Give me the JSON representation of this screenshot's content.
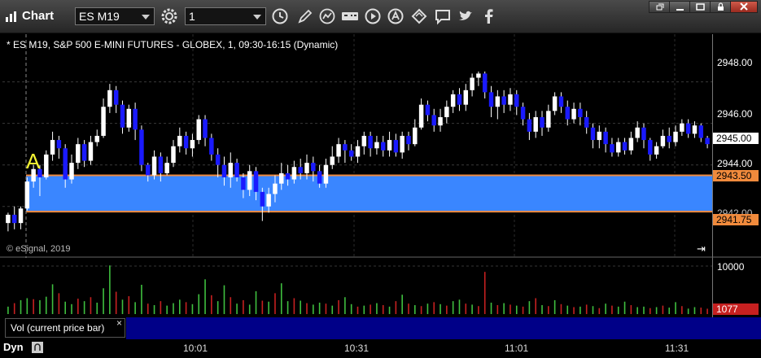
{
  "app": {
    "title": "Chart"
  },
  "toolbar": {
    "symbol_value": "ES M19",
    "interval_value": "1",
    "icons": [
      "gear-icon",
      "clock-icon",
      "pencil-icon",
      "studies-icon",
      "get-icon",
      "play-icon",
      "alert-icon",
      "link-icon",
      "chat-icon",
      "twitter-icon",
      "facebook-icon"
    ]
  },
  "chart": {
    "title": "* ES M19, S&P 500 E-MINI FUTURES - GLOBEX, 1, 09:30-16:15 (Dynamic)",
    "copyright": "© eSignal, 2019",
    "marker_label": "A",
    "price_axis": [
      "2948.00",
      "2946.00",
      "2944.00",
      "2942.00"
    ],
    "last_price": "2945.00",
    "zone_top": "2943.50",
    "zone_bottom": "2941.75",
    "volume_axis": "10000",
    "volume_last": "1077",
    "time_labels": [
      "10:01",
      "10:31",
      "11:01",
      "11:31"
    ],
    "legend": "Vol (current price bar)",
    "legend_close": "×",
    "bottom_label": "Dyn",
    "colors": {
      "up": "#ffffff",
      "down": "#1a1aff",
      "zone": "#3a86ff",
      "zone_line": "#f08a3c",
      "vol_up": "#3fbf3f",
      "vol_down": "#c62020"
    }
  },
  "chart_data": {
    "type": "candlestick",
    "ylim": [
      2940.5,
      2949.2
    ],
    "zone": [
      2941.75,
      2943.5
    ],
    "candles": [
      [
        2941.2,
        2941.6,
        2940.8,
        2941.7
      ],
      [
        2941.6,
        2941.2,
        2940.9,
        2942.0
      ],
      [
        2941.2,
        2941.9,
        2940.9,
        2942.0
      ],
      [
        2941.9,
        2943.2,
        2941.8,
        2943.4
      ],
      [
        2943.2,
        2943.8,
        2942.9,
        2944.0
      ],
      [
        2943.8,
        2943.4,
        2942.5,
        2944.0
      ],
      [
        2943.4,
        2944.5,
        2943.3,
        2944.7
      ],
      [
        2944.5,
        2945.2,
        2944.2,
        2945.6
      ],
      [
        2945.2,
        2944.8,
        2944.3,
        2945.4
      ],
      [
        2944.8,
        2943.3,
        2942.9,
        2945.0
      ],
      [
        2943.3,
        2944.1,
        2943.1,
        2944.5
      ],
      [
        2944.1,
        2945.0,
        2943.8,
        2945.3
      ],
      [
        2945.0,
        2944.2,
        2943.9,
        2945.2
      ],
      [
        2944.2,
        2945.1,
        2944.0,
        2945.4
      ],
      [
        2945.1,
        2945.4,
        2944.9,
        2945.7
      ],
      [
        2945.4,
        2946.8,
        2945.3,
        2947.2
      ],
      [
        2946.8,
        2947.6,
        2946.5,
        2947.9
      ],
      [
        2947.6,
        2946.9,
        2946.5,
        2947.8
      ],
      [
        2946.9,
        2945.8,
        2945.5,
        2947.1
      ],
      [
        2945.8,
        2946.7,
        2945.6,
        2946.9
      ],
      [
        2946.7,
        2945.7,
        2945.2,
        2947.0
      ],
      [
        2945.7,
        2944.0,
        2943.7,
        2945.9
      ],
      [
        2944.0,
        2943.5,
        2943.2,
        2944.1
      ],
      [
        2943.5,
        2944.4,
        2943.3,
        2944.7
      ],
      [
        2944.4,
        2943.6,
        2943.2,
        2944.6
      ],
      [
        2943.6,
        2944.1,
        2943.5,
        2944.4
      ],
      [
        2944.1,
        2944.9,
        2943.9,
        2945.2
      ],
      [
        2944.9,
        2945.4,
        2944.6,
        2945.8
      ],
      [
        2945.4,
        2944.8,
        2944.5,
        2945.6
      ],
      [
        2944.8,
        2945.2,
        2944.4,
        2945.5
      ],
      [
        2945.2,
        2946.2,
        2945.0,
        2946.4
      ],
      [
        2946.2,
        2945.3,
        2944.9,
        2946.4
      ],
      [
        2945.3,
        2944.5,
        2944.2,
        2945.5
      ],
      [
        2944.5,
        2944.0,
        2943.4,
        2944.8
      ],
      [
        2944.0,
        2943.4,
        2943.0,
        2944.4
      ],
      [
        2943.4,
        2944.1,
        2942.9,
        2944.6
      ],
      [
        2944.1,
        2943.4,
        2943.2,
        2944.3
      ],
      [
        2943.4,
        2942.8,
        2942.4,
        2943.6
      ],
      [
        2942.8,
        2943.7,
        2942.5,
        2944.0
      ],
      [
        2943.7,
        2942.7,
        2942.3,
        2943.9
      ],
      [
        2942.7,
        2942.0,
        2941.3,
        2942.9
      ],
      [
        2942.0,
        2942.6,
        2941.7,
        2942.9
      ],
      [
        2942.6,
        2943.1,
        2942.2,
        2943.5
      ],
      [
        2943.1,
        2943.6,
        2942.8,
        2944.1
      ],
      [
        2943.6,
        2943.3,
        2943.0,
        2944.0
      ],
      [
        2943.3,
        2943.9,
        2943.1,
        2944.2
      ],
      [
        2943.9,
        2943.6,
        2943.3,
        2944.3
      ],
      [
        2943.6,
        2944.1,
        2943.3,
        2944.5
      ],
      [
        2944.1,
        2943.7,
        2943.2,
        2944.4
      ],
      [
        2943.7,
        2943.1,
        2942.9,
        2944.0
      ],
      [
        2943.1,
        2944.0,
        2942.9,
        2944.3
      ],
      [
        2944.0,
        2944.4,
        2943.8,
        2944.9
      ],
      [
        2944.4,
        2945.0,
        2944.1,
        2945.3
      ],
      [
        2945.0,
        2944.7,
        2944.1,
        2945.2
      ],
      [
        2944.7,
        2944.4,
        2944.2,
        2945.0
      ],
      [
        2944.4,
        2944.9,
        2944.1,
        2945.2
      ],
      [
        2944.9,
        2945.4,
        2944.5,
        2945.6
      ],
      [
        2945.4,
        2944.8,
        2944.4,
        2945.6
      ],
      [
        2944.8,
        2945.1,
        2944.5,
        2945.4
      ],
      [
        2945.1,
        2944.7,
        2944.4,
        2945.4
      ],
      [
        2944.7,
        2945.2,
        2944.4,
        2945.6
      ],
      [
        2945.2,
        2944.6,
        2944.4,
        2945.5
      ],
      [
        2944.6,
        2945.4,
        2944.3,
        2945.6
      ],
      [
        2945.4,
        2945.0,
        2944.7,
        2945.6
      ],
      [
        2945.0,
        2945.8,
        2944.9,
        2946.2
      ],
      [
        2945.8,
        2946.9,
        2945.7,
        2947.2
      ],
      [
        2946.9,
        2946.4,
        2946.1,
        2947.1
      ],
      [
        2946.4,
        2945.9,
        2945.6,
        2946.7
      ],
      [
        2945.9,
        2946.3,
        2945.6,
        2946.7
      ],
      [
        2946.3,
        2946.8,
        2946.0,
        2947.1
      ],
      [
        2946.8,
        2947.4,
        2946.5,
        2947.6
      ],
      [
        2947.4,
        2946.9,
        2946.6,
        2947.7
      ],
      [
        2946.9,
        2947.6,
        2946.6,
        2947.9
      ],
      [
        2947.6,
        2948.2,
        2947.3,
        2948.4
      ],
      [
        2948.2,
        2948.4,
        2947.8,
        2948.5
      ],
      [
        2948.4,
        2947.5,
        2947.2,
        2948.5
      ],
      [
        2947.5,
        2946.8,
        2946.3,
        2947.8
      ],
      [
        2946.8,
        2947.3,
        2946.2,
        2947.6
      ],
      [
        2947.3,
        2946.9,
        2946.5,
        2947.6
      ],
      [
        2946.9,
        2947.4,
        2946.6,
        2947.7
      ],
      [
        2947.4,
        2946.8,
        2946.4,
        2947.6
      ],
      [
        2946.8,
        2946.2,
        2945.9,
        2947.0
      ],
      [
        2946.2,
        2945.6,
        2945.2,
        2946.5
      ],
      [
        2945.6,
        2946.3,
        2945.3,
        2946.6
      ],
      [
        2946.3,
        2945.8,
        2945.4,
        2946.6
      ],
      [
        2945.8,
        2946.6,
        2945.6,
        2946.9
      ],
      [
        2946.6,
        2947.3,
        2946.4,
        2947.5
      ],
      [
        2947.3,
        2946.8,
        2946.5,
        2947.5
      ],
      [
        2946.8,
        2946.2,
        2945.9,
        2947.1
      ],
      [
        2946.2,
        2946.7,
        2946.0,
        2947.0
      ],
      [
        2946.7,
        2946.3,
        2945.9,
        2947.0
      ],
      [
        2946.3,
        2945.8,
        2945.5,
        2946.6
      ],
      [
        2945.8,
        2945.2,
        2944.8,
        2946.0
      ],
      [
        2945.2,
        2945.6,
        2944.8,
        2945.9
      ],
      [
        2945.6,
        2945.0,
        2944.6,
        2945.8
      ],
      [
        2945.0,
        2944.6,
        2944.4,
        2945.3
      ],
      [
        2944.6,
        2945.1,
        2944.4,
        2945.3
      ],
      [
        2945.1,
        2944.7,
        2944.5,
        2945.3
      ],
      [
        2944.7,
        2945.3,
        2944.5,
        2945.6
      ],
      [
        2945.3,
        2945.8,
        2945.1,
        2946.1
      ],
      [
        2945.8,
        2945.2,
        2944.8,
        2946.0
      ],
      [
        2945.2,
        2944.5,
        2944.2,
        2945.3
      ],
      [
        2944.5,
        2944.9,
        2944.3,
        2945.1
      ],
      [
        2944.9,
        2945.4,
        2944.8,
        2945.7
      ],
      [
        2945.4,
        2945.1,
        2944.8,
        2945.8
      ],
      [
        2945.1,
        2945.6,
        2944.9,
        2945.9
      ],
      [
        2945.6,
        2946.0,
        2945.4,
        2946.2
      ],
      [
        2946.0,
        2945.5,
        2945.3,
        2946.2
      ],
      [
        2945.5,
        2945.9,
        2945.3,
        2946.1
      ],
      [
        2945.9,
        2945.3,
        2945.1,
        2946.0
      ],
      [
        2945.3,
        2945.0,
        2944.8,
        2945.4
      ]
    ],
    "volume": [
      [
        1500,
        1
      ],
      [
        2200,
        0
      ],
      [
        2800,
        1
      ],
      [
        3200,
        1
      ],
      [
        3000,
        0
      ],
      [
        2800,
        1
      ],
      [
        3500,
        1
      ],
      [
        6000,
        1
      ],
      [
        4200,
        0
      ],
      [
        2500,
        1
      ],
      [
        2000,
        1
      ],
      [
        3100,
        0
      ],
      [
        2600,
        1
      ],
      [
        3400,
        0
      ],
      [
        2300,
        1
      ],
      [
        5200,
        1
      ],
      [
        9800,
        1
      ],
      [
        4500,
        0
      ],
      [
        2900,
        1
      ],
      [
        3600,
        0
      ],
      [
        2400,
        1
      ],
      [
        5900,
        1
      ],
      [
        2100,
        0
      ],
      [
        1800,
        1
      ],
      [
        2600,
        0
      ],
      [
        1700,
        1
      ],
      [
        2200,
        1
      ],
      [
        2900,
        1
      ],
      [
        2400,
        0
      ],
      [
        2000,
        1
      ],
      [
        4000,
        1
      ],
      [
        7000,
        1
      ],
      [
        3800,
        0
      ],
      [
        2600,
        1
      ],
      [
        5800,
        1
      ],
      [
        3400,
        0
      ],
      [
        2100,
        1
      ],
      [
        2800,
        0
      ],
      [
        1900,
        1
      ],
      [
        4600,
        1
      ],
      [
        2700,
        0
      ],
      [
        2500,
        1
      ],
      [
        4200,
        0
      ],
      [
        6200,
        1
      ],
      [
        2600,
        1
      ],
      [
        3200,
        0
      ],
      [
        2700,
        1
      ],
      [
        2200,
        0
      ],
      [
        1900,
        1
      ],
      [
        2300,
        1
      ],
      [
        2100,
        0
      ],
      [
        1700,
        1
      ],
      [
        2800,
        0
      ],
      [
        3400,
        1
      ],
      [
        2000,
        1
      ],
      [
        1500,
        0
      ],
      [
        1700,
        1
      ],
      [
        1900,
        0
      ],
      [
        2200,
        1
      ],
      [
        1800,
        0
      ],
      [
        1500,
        1
      ],
      [
        2600,
        0
      ],
      [
        3900,
        1
      ],
      [
        2100,
        0
      ],
      [
        1800,
        1
      ],
      [
        1600,
        0
      ],
      [
        2100,
        1
      ],
      [
        2400,
        0
      ],
      [
        2000,
        1
      ],
      [
        1700,
        0
      ],
      [
        2600,
        1
      ],
      [
        2900,
        1
      ],
      [
        2100,
        0
      ],
      [
        1900,
        1
      ],
      [
        1600,
        0
      ],
      [
        8500,
        0
      ],
      [
        2300,
        1
      ],
      [
        1800,
        0
      ],
      [
        2200,
        1
      ],
      [
        1900,
        0
      ],
      [
        1700,
        1
      ],
      [
        1500,
        0
      ],
      [
        2600,
        1
      ],
      [
        3200,
        0
      ],
      [
        1800,
        1
      ],
      [
        1600,
        0
      ],
      [
        2800,
        1
      ],
      [
        2000,
        0
      ],
      [
        1700,
        1
      ],
      [
        1400,
        0
      ],
      [
        1500,
        1
      ],
      [
        1900,
        0
      ],
      [
        1600,
        1
      ],
      [
        1200,
        0
      ],
      [
        2100,
        1
      ],
      [
        1700,
        0
      ],
      [
        1500,
        1
      ],
      [
        2500,
        1
      ],
      [
        1800,
        0
      ],
      [
        1400,
        1
      ],
      [
        1500,
        1
      ],
      [
        1200,
        0
      ],
      [
        1400,
        1
      ],
      [
        1700,
        0
      ],
      [
        1300,
        1
      ],
      [
        2400,
        1
      ],
      [
        1600,
        0
      ],
      [
        1100,
        1
      ],
      [
        1400,
        1
      ],
      [
        1300,
        0
      ],
      [
        1077,
        0
      ]
    ]
  }
}
